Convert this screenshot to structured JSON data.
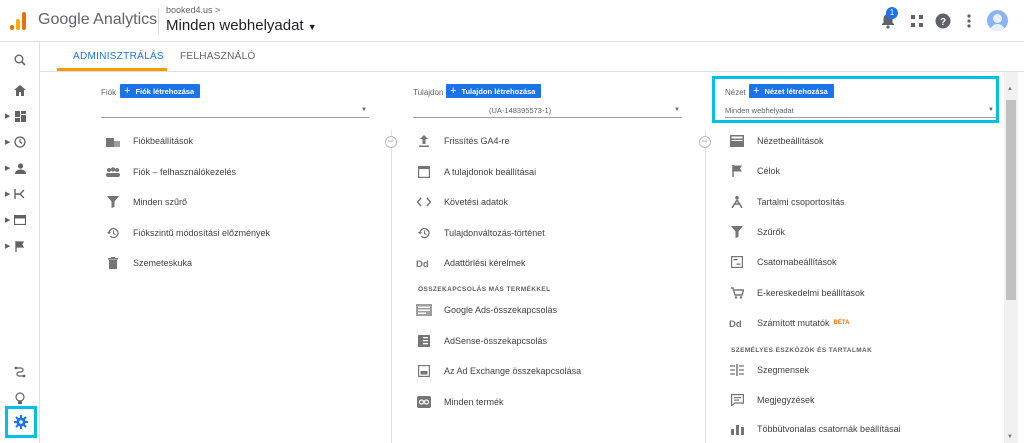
{
  "header": {
    "brand": "Google Analytics",
    "account_small": "booked4.us >",
    "account_big": "Minden webhelyadat",
    "notif_count": "1"
  },
  "tabs": [
    {
      "label": "ADMINISZTRÁLÁS"
    },
    {
      "label": "FELHASZNÁLÓ"
    }
  ],
  "account_col": {
    "label": "Fiók",
    "create": "Fiók létrehozása",
    "items": [
      {
        "label": "Fiókbeállítások",
        "icon": "building-icon"
      },
      {
        "label": "Fiók – felhasználókezelés",
        "icon": "people-icon"
      },
      {
        "label": "Minden szűrő",
        "icon": "filter-icon"
      },
      {
        "label": "Fiókszintű módosítási előzmények",
        "icon": "history-icon"
      },
      {
        "label": "Szemeteskuka",
        "icon": "trash-icon"
      }
    ]
  },
  "property_col": {
    "label": "Tulajdon",
    "create": "Tulajdon létrehozása",
    "selected": "(UA-148395573-1)",
    "items": [
      {
        "label": "Frissítés GA4-re",
        "icon": "upload-icon"
      },
      {
        "label": "A tulajdonok beállításai",
        "icon": "window-icon"
      },
      {
        "label": "Követési adatok",
        "icon": "code-icon"
      },
      {
        "label": "Tulajdonváltozás-történet",
        "icon": "history-icon"
      },
      {
        "label": "Adattörlési kérelmek",
        "icon": "dd-icon"
      }
    ],
    "section": "ÖSSZEKAPCSOLÁS MÁS TERMÉKKEL",
    "link_items": [
      {
        "label": "Google Ads-összekapcsolás",
        "icon": "ads-icon"
      },
      {
        "label": "AdSense-összekapcsolás",
        "icon": "adsense-icon"
      },
      {
        "label": "Az Ad Exchange összekapcsolása",
        "icon": "adx-icon"
      },
      {
        "label": "Minden termék",
        "icon": "link-icon"
      }
    ]
  },
  "view_col": {
    "label": "Nézet",
    "create": "Nézet létrehozása",
    "selected": "Minden webhelyadat",
    "items": [
      {
        "label": "Nézetbeállítások",
        "icon": "document-icon"
      },
      {
        "label": "Célok",
        "icon": "flag-icon"
      },
      {
        "label": "Tartalmi csoportosítás",
        "icon": "person-walk-icon"
      },
      {
        "label": "Szűrők",
        "icon": "filter-icon"
      },
      {
        "label": "Csatornabeállítások",
        "icon": "channel-icon"
      },
      {
        "label": "E-kereskedelmi beállítások",
        "icon": "cart-icon"
      },
      {
        "label": "Számított mutatók",
        "icon": "dd-icon",
        "badge": "BÉTA"
      }
    ],
    "section": "SZEMÉLYES ESZKÖZÖK ÉS TARTALMAK",
    "tool_items": [
      {
        "label": "Szegmensek",
        "icon": "segments-icon"
      },
      {
        "label": "Megjegyzések",
        "icon": "comment-icon"
      },
      {
        "label": "Többütvonalas csatornák beállításai",
        "icon": "bar-icon"
      }
    ]
  },
  "colors": {
    "accent": "#1a73e8",
    "tab_underline": "#ff9800",
    "highlight": "#00c0e8"
  }
}
